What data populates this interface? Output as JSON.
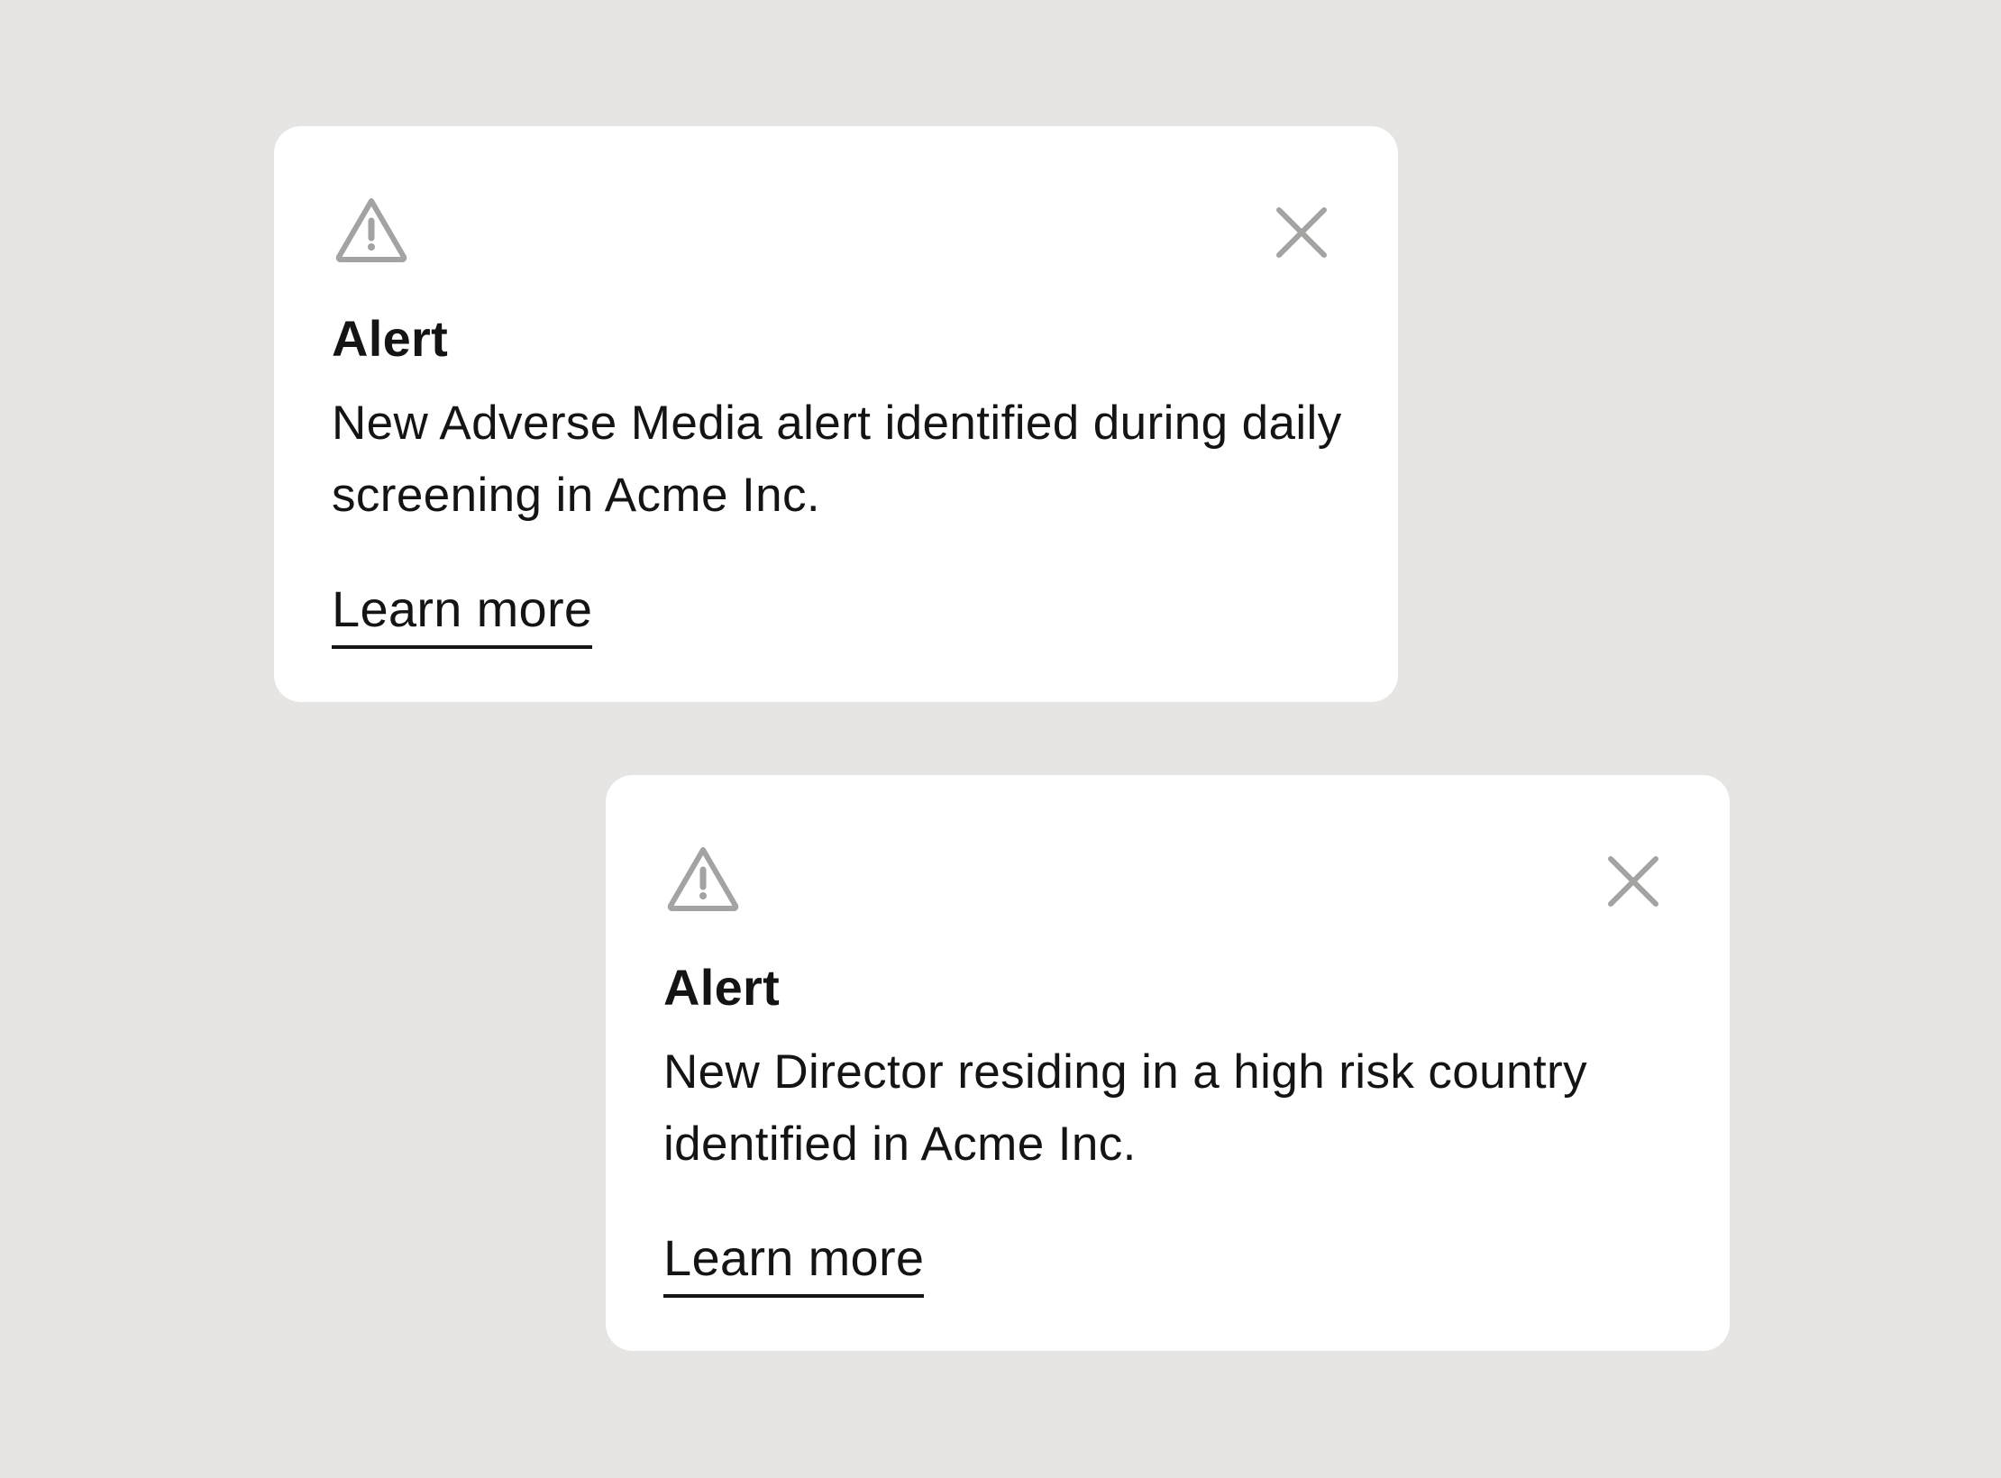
{
  "colors": {
    "background": "#e6e5e3",
    "card": "#ffffff",
    "text": "#141414",
    "icon": "#a3a3a1"
  },
  "alerts": [
    {
      "icon": "warning-triangle-icon",
      "close_icon": "close-icon",
      "title": "Alert",
      "message": "New Adverse Media alert identified during daily screening in Acme Inc.",
      "link_label": "Learn more"
    },
    {
      "icon": "warning-triangle-icon",
      "close_icon": "close-icon",
      "title": "Alert",
      "message": "New Director residing in a high risk country identified in Acme Inc.",
      "link_label": "Learn more"
    }
  ]
}
